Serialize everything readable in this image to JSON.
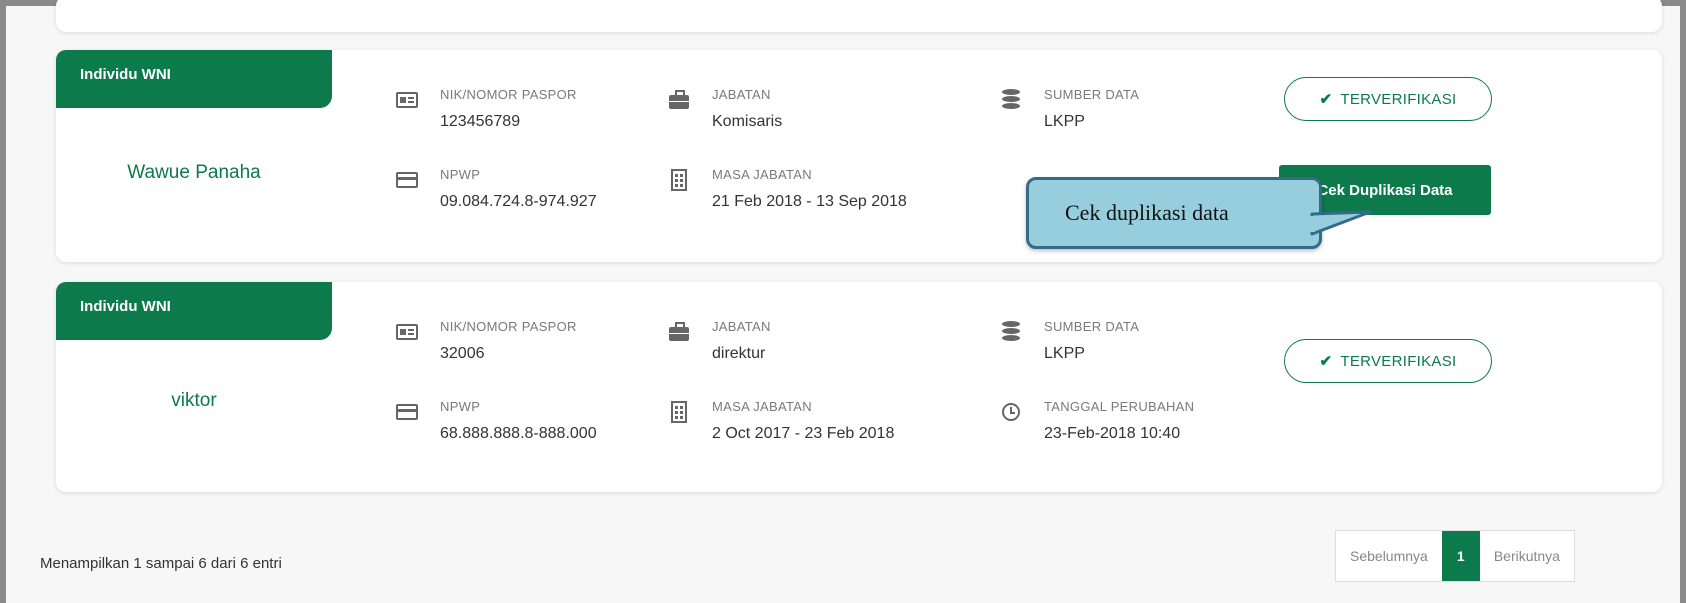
{
  "entries": [
    {
      "type": "Individu WNI",
      "name": "Wawue Panaha",
      "nik_label": "NIK/NOMOR PASPOR",
      "nik_value": "123456789",
      "npwp_label": "NPWP",
      "npwp_value": "09.084.724.8-974.927",
      "jabatan_label": "JABATAN",
      "jabatan_value": "Komisaris",
      "masa_label": "MASA JABATAN",
      "masa_value": "21 Feb 2018 - 13 Sep 2018",
      "sumber_label": "SUMBER DATA",
      "sumber_value": "LKPP",
      "status": "TERVERIFIKASI",
      "action_button": "Cek Duplikasi Data"
    },
    {
      "type": "Individu WNI",
      "name": "viktor",
      "nik_label": "NIK/NOMOR PASPOR",
      "nik_value": "32006",
      "npwp_label": "NPWP",
      "npwp_value": "68.888.888.8-888.000",
      "jabatan_label": "JABATAN",
      "jabatan_value": "direktur",
      "masa_label": "MASA JABATAN",
      "masa_value": "2 Oct 2017 - 23 Feb 2018",
      "sumber_label": "SUMBER DATA",
      "sumber_value": "LKPP",
      "tanggal_label": "TANGGAL PERUBAHAN",
      "tanggal_value": "23-Feb-2018 10:40",
      "status": "TERVERIFIKASI"
    }
  ],
  "callout": {
    "text": "Cek duplikasi data"
  },
  "footer": {
    "info": "Menampilkan 1 sampai 6 dari 6 entri"
  },
  "pagination": {
    "prev": "Sebelumnya",
    "current": "1",
    "next": "Berikutnya"
  },
  "colors": {
    "accent": "#0c7a4b",
    "callout_fill": "#96cedd",
    "callout_border": "#336b88"
  }
}
